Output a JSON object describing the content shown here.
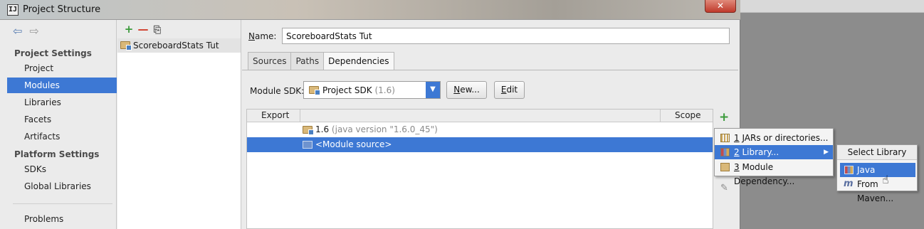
{
  "window": {
    "title": "Project Structure",
    "close_glyph": "✕",
    "app_icon_label": "IJ"
  },
  "sidebar": {
    "nav_back": "⇦",
    "nav_forward": "⇨",
    "project_settings_header": "Project Settings",
    "platform_settings_header": "Platform Settings",
    "items": [
      {
        "label": "Project"
      },
      {
        "label": "Modules",
        "selected": true
      },
      {
        "label": "Libraries"
      },
      {
        "label": "Facets"
      },
      {
        "label": "Artifacts"
      },
      {
        "label": "SDKs"
      },
      {
        "label": "Global Libraries"
      },
      {
        "label": "Problems"
      }
    ]
  },
  "modules": {
    "toolbar": {
      "add": "+",
      "remove": "—",
      "copy": "⎘"
    },
    "list": [
      {
        "label": "ScoreboardStats Tut",
        "selected": true
      }
    ]
  },
  "main": {
    "name_label_accel": "N",
    "name_label_rest": "ame:",
    "name_value": "ScoreboardStats Tut",
    "tabs": [
      {
        "label": "Sources"
      },
      {
        "label": "Paths"
      },
      {
        "label": "Dependencies",
        "active": true
      }
    ],
    "sdk_label": "Module SDK:",
    "sdk_value": "Project SDK",
    "sdk_version": "(1.6)",
    "new_button_accel": "N",
    "new_button_rest": "ew...",
    "edit_button_accel": "E",
    "edit_button_rest": "dit",
    "table": {
      "col_export": "Export",
      "col_scope": "Scope",
      "rows": [
        {
          "name": "1.6",
          "detail": "(java version \"1.6.0_45\")"
        },
        {
          "name": "<Module source>",
          "selected": true
        }
      ]
    },
    "side_add": "+",
    "side_edit": "✎"
  },
  "popup_menu": {
    "items": [
      {
        "accel": "1",
        "label": "JARs or directories...",
        "icon": "jar-icon"
      },
      {
        "accel": "2",
        "label": "Library...",
        "icon": "library-icon",
        "selected": true,
        "has_submenu": true
      },
      {
        "accel": "3",
        "label": "Module Dependency...",
        "icon": "module-dependency-icon"
      }
    ],
    "submenu_arrow": "▶"
  },
  "submenu": {
    "title": "Select Library Type",
    "items": [
      {
        "label": "Java",
        "icon": "java-library-icon",
        "selected": true
      },
      {
        "label": "From Maven...",
        "icon": "maven-icon"
      }
    ]
  },
  "sdk_dropdown_arrow": "▼",
  "colors": {
    "selection": "#3d78d4",
    "add_green": "#3a9a3a",
    "remove_red": "#d0402e"
  }
}
